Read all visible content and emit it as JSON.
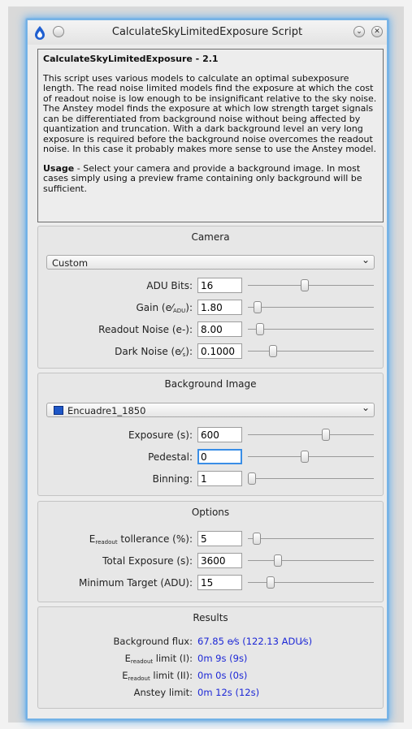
{
  "window": {
    "title": "CalculateSkyLimitedExposure Script"
  },
  "info": {
    "heading": "CalculateSkyLimitedExposure - 2.1",
    "paragraph": "This script uses various models to calculate an optimal subexposure length. The read noise limited models find the exposure at which the cost of readout noise is low enough to be insignificant relative to the sky noise. The Anstey model finds the exposure at which low strength target signals can be differentiated from background noise without being affected by quantization and truncation. With a dark background level an very long exposure is required before the background noise overcomes the readout noise. In this case it probably makes more sense to use the Anstey model.",
    "usage_label": "Usage",
    "usage_text": " - Select your camera and provide a background image. In most cases simply using a preview frame containing only background will be sufficient."
  },
  "camera": {
    "title": "Camera",
    "camera_select": "Custom",
    "fields": [
      {
        "label": "ADU Bits:",
        "value": "16",
        "slider": 0.45
      },
      {
        "label_main": "Gain (",
        "label_tail": "):",
        "value": "1.80",
        "slider": 0.05
      },
      {
        "label": "Readout Noise (e-):",
        "value": "8.00",
        "slider": 0.07
      },
      {
        "label_main": "Dark Noise (",
        "label_tail": "):",
        "value": "0.1000",
        "slider": 0.18
      }
    ]
  },
  "background": {
    "title": "Background Image",
    "image_select": "Encuadre1_1850",
    "fields": [
      {
        "label": "Exposure (s):",
        "value": "600",
        "slider": 0.63
      },
      {
        "label": "Pedestal:",
        "value": "0",
        "slider": 0.45
      },
      {
        "label": "Binning:",
        "value": "1",
        "slider": 0.0
      }
    ]
  },
  "options": {
    "title": "Options",
    "fields": [
      {
        "label_pre": "E",
        "label_sub": "readout",
        "label_post": " tollerance (%):",
        "value": "5",
        "slider": 0.04
      },
      {
        "label": "Total Exposure (s):",
        "value": "3600",
        "slider": 0.22
      },
      {
        "label": "Minimum Target (ADU):",
        "value": "15",
        "slider": 0.16
      }
    ]
  },
  "results": {
    "title": "Results",
    "rows": [
      {
        "label": "Background flux:",
        "value": "67.85 e⁄s (122.13 ADU⁄s)"
      },
      {
        "label_pre": "E",
        "label_sub": "readout",
        "label_post": " limit (I):",
        "value": "0m 9s (9s)"
      },
      {
        "label_pre": "E",
        "label_sub": "readout",
        "label_post": " limit (II):",
        "value": "0m 0s (0s)"
      },
      {
        "label": "Anstey limit:",
        "value": "0m 12s (12s)"
      }
    ]
  },
  "colors": {
    "accent_glow": "#6db3ee",
    "result_text": "#1c27d6"
  }
}
